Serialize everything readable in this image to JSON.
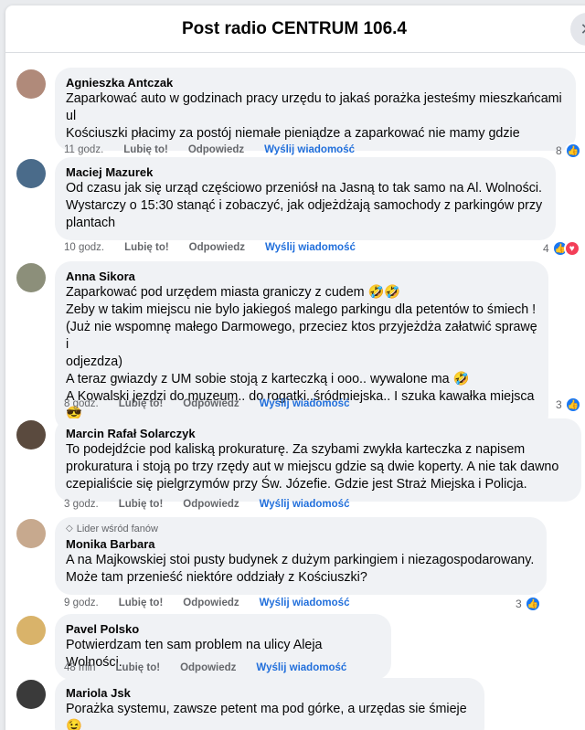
{
  "header": {
    "title": "Post radio CENTRUM 106.4"
  },
  "labels": {
    "like": "Lubię to!",
    "reply": "Odpowiedz",
    "message": "Wyślij wiadomość"
  },
  "comments": [
    {
      "author": "Agnieszka Antczak",
      "text": "Zaparkować auto w godzinach pracy urzędu to jakaś porażka jesteśmy mieszkańcami ul\nKościuszki płacimy za postój niemałe pieniądze a zaparkować nie mamy gdzie",
      "time": "11 godz.",
      "reactions": "8",
      "avatar_color": "#b08a7a"
    },
    {
      "author": "Maciej Mazurek",
      "text": "Od czasu jak się urząd częściowo przeniósł na Jasną to tak samo na Al. Wolności.\nWystarczy o 15:30 stanąć i zobaczyć, jak odjeżdżają samochody z parkingów przy\nplantach",
      "time": "10 godz.",
      "reactions": "4",
      "avatar_color": "#4a6b8a"
    },
    {
      "author": "Anna Sikora",
      "text": "Zaparkować pod urzędem miasta graniczy z cudem 🤣🤣\nZeby w takim miejscu nie bylo jakiegoś malego parkingu dla petentów to śmiech !\n(Już nie wspomnę małego Darmowego, przeciez ktos przyjeżdża załatwić sprawę i\nodjezdza)\nA teraz gwiazdy z UM sobie stoją z karteczką i ooo.. wywalone ma 🤣\nA Kowalski jezdzi do muzeum.. do rogatki..śródmiejska.. I szuka kawałka miejsca 😎",
      "time": "8 godz.",
      "reactions": "3",
      "avatar_color": "#8c8f7a"
    },
    {
      "author": "Marcin Rafał Solarczyk",
      "text": "To podejdźcie pod kaliską prokuraturę. Za szybami zwykła karteczka z napisem\nprokuratura i stoją po trzy rzędy aut w miejscu gdzie są dwie koperty. A nie tak dawno\nczepialiście się pielgrzymów przy Św. Józefie. Gdzie jest Straż Miejska i Policja.",
      "time": "3 godz.",
      "reactions": "",
      "avatar_color": "#5a4a3e"
    },
    {
      "badge": "Lider wśród fanów",
      "author": "Monika Barbara",
      "text": "A na Majkowskiej stoi pusty budynek z dużym parkingiem i niezagospodarowany.\nMoże tam przenieść niektóre oddziały z Kościuszki?",
      "time": "9 godz.",
      "reactions": "3",
      "avatar_color": "#c7a98e"
    },
    {
      "author": "Pavel Polsko",
      "text": "Potwierdzam ten sam problem na ulicy Aleja Wolności.",
      "time": "48 min",
      "reactions": "",
      "avatar_color": "#d9b36a"
    },
    {
      "author": "Mariola Jsk",
      "text": "Porażka systemu, zawsze petent ma pod górke, a urzędas sie śmieje 😉",
      "time": "",
      "reactions": "",
      "avatar_color": "#3a3a3a"
    }
  ],
  "colors": {
    "link": "#216fdb",
    "like": "#1877f2",
    "love": "#f33e58",
    "bubble": "#f0f2f5"
  },
  "icons": {
    "close": "close-icon",
    "like": "like-icon",
    "love": "love-icon",
    "badge": "diamond-icon"
  }
}
